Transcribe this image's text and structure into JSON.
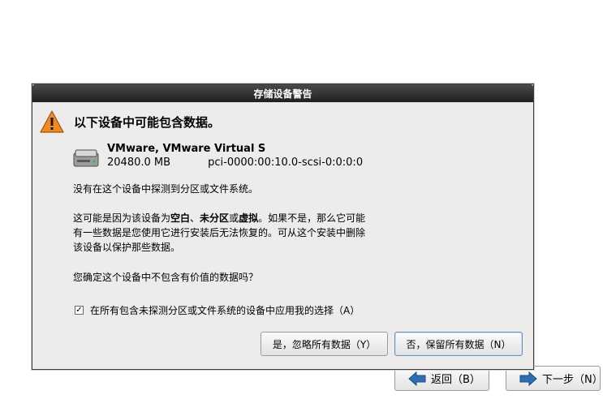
{
  "background_nav": {
    "back_label": "返回（B）",
    "next_label": "下一步（N）"
  },
  "dialog": {
    "title": "存储设备警告",
    "heading": "以下设备中可能包含数据。",
    "device": {
      "name": "VMware, VMware Virtual S",
      "size": "20480.0 MB",
      "path": "pci-0000:00:10.0-scsi-0:0:0:0"
    },
    "paragraph1": "没有在这个设备中探测到分区或文件系统。",
    "paragraph2_parts": {
      "prefix": "这可能是因为该设备为",
      "blank": "空白",
      "sep1": "、",
      "unpartitioned": "未分区",
      "sep2": "或",
      "virtual": "虚拟",
      "suffix_line1": "。如果不是，那么它可能",
      "line2": "有一些数据是您使用它进行安装后无法恢复的。可从这个安装中删除",
      "line3": "该设备以保护那些数据。"
    },
    "question": "您确定这个设备中不包含有价值的数据吗？",
    "checkbox": {
      "label": "在所有包含未探测分区或文件系统的设备中应用我的选择（A）",
      "checked": true
    },
    "buttons": {
      "ignore": "是，忽略所有数据（Y）",
      "keep": "否，保留所有数据（N）"
    }
  },
  "icons": {
    "warning": "warning-icon",
    "disk": "hard-disk-icon",
    "back_arrow": "left-arrow-icon",
    "next_arrow": "right-arrow-icon"
  },
  "colors": {
    "titlebar": "#2b2b2b",
    "dialog_bg": "#edeceb",
    "arrow_blue": "#2f6eb5",
    "warning_orange": "#f08a24"
  }
}
